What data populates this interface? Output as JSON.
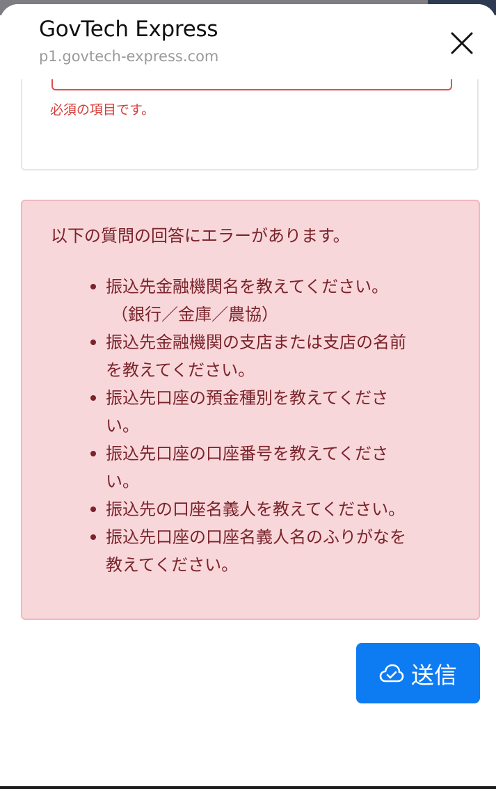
{
  "header": {
    "title": "GovTech Express",
    "url": "p1.govtech-express.com"
  },
  "previous_field": {
    "error_message": "必須の項目です。"
  },
  "error_summary": {
    "heading": "以下の質問の回答にエラーがあります。",
    "items": [
      {
        "lines": [
          "振込先金融機関名を教えてください。",
          "（銀行／金庫／農協）"
        ]
      },
      {
        "lines": [
          "振込先金融機関の支店または支店の名前",
          "を教えてください。"
        ]
      },
      {
        "lines": [
          "振込先口座の預金種別を教えてくださ",
          "い。"
        ]
      },
      {
        "lines": [
          "振込先口座の口座番号を教えてくださ",
          "い。"
        ]
      },
      {
        "lines": [
          "振込先の口座名義人を教えてください。"
        ]
      },
      {
        "lines": [
          "振込先口座の口座名義人名のふりがなを",
          "教えてください。"
        ]
      }
    ]
  },
  "submit_button": {
    "label": "送信",
    "icon": "cloud-check-icon"
  },
  "colors": {
    "accent": "#0d7bf2",
    "error_text": "#d43f3a",
    "alert_bg": "#f8d7da",
    "alert_text": "#7a232b"
  }
}
